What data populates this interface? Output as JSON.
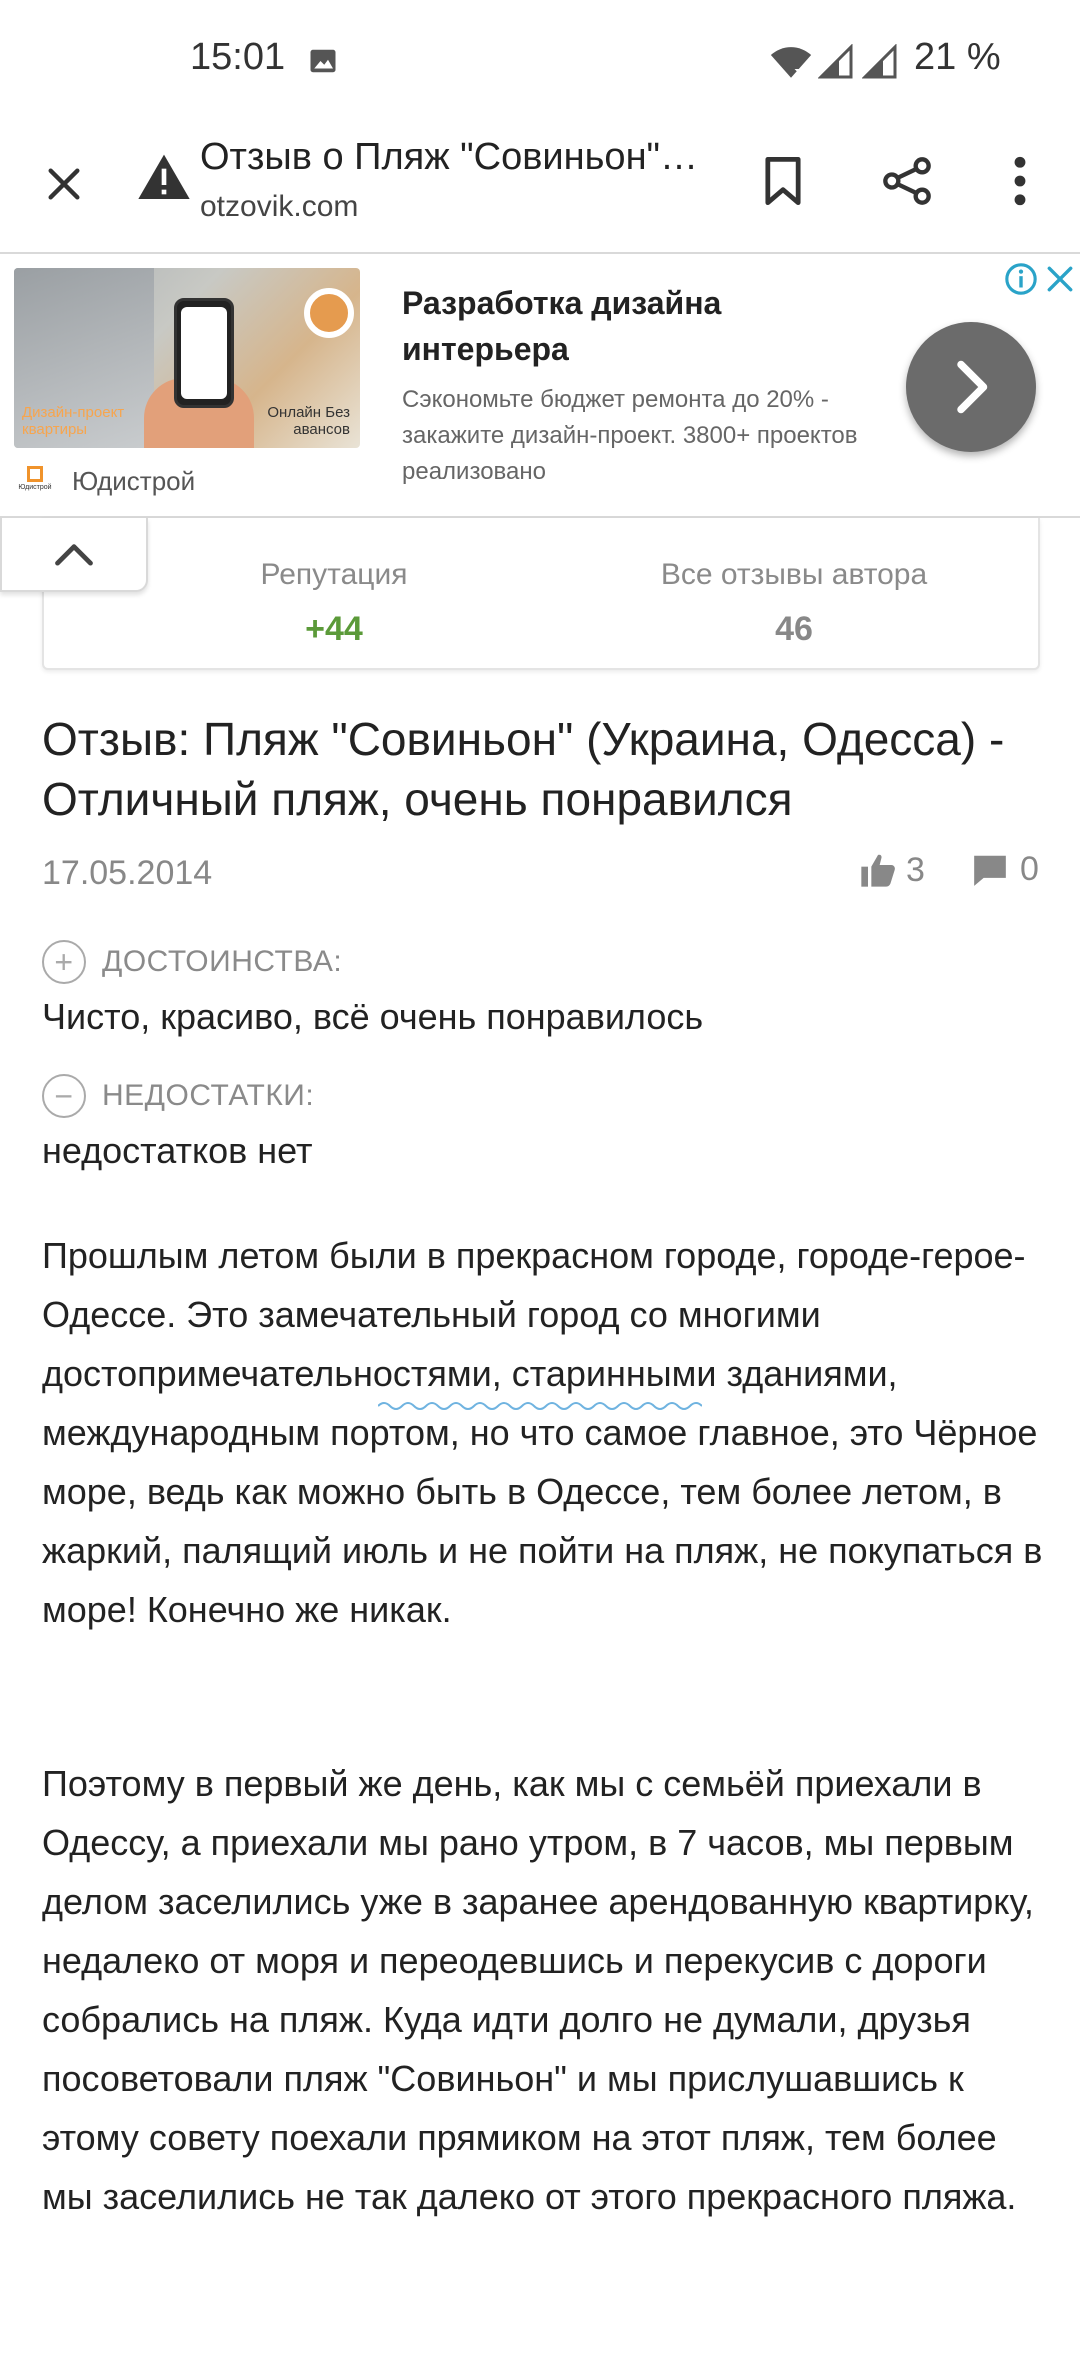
{
  "status_bar": {
    "time": "15:01",
    "battery": "21 %"
  },
  "toolbar": {
    "title": "Отзыв о Пляж \"Совиньон\" (Украина, Одесса)",
    "url": "otzovik.com"
  },
  "ad": {
    "image_text_left": "Дизайн-проект квартиры",
    "image_text_right": "Онлайн Без авансов",
    "brand": "Юдистрой",
    "logo_label": "Юдистрой",
    "headline": "Разработка дизайна интерьера",
    "description": "Сэкономьте бюджет ремонта до 20% - закажите дизайн-проект. 3800+ проектов реализовано"
  },
  "author_stats": {
    "reputation_label": "Репутация",
    "reputation_value": "+44",
    "reviews_label": "Все отзывы автора",
    "reviews_value": "46"
  },
  "review": {
    "title": "Отзыв: Пляж \"Совиньон\" (Украина, Одесса) - Отличный пляж, очень понравился",
    "date": "17.05.2014",
    "likes": "3",
    "comments": "0",
    "pros_label": "ДОСТОИНСТВА:",
    "pros_text": "Чисто, красиво, всё очень понравилось",
    "cons_label": "НЕДОСТАТКИ:",
    "cons_text": "недостатков нет",
    "paragraph1": "Прошлым летом были в прекрасном городе, городе-герое- Одессе. Это замечательный город со многими достопримечательностями, старинными зданиями, международным портом, но что самое главное, это Чёрное море, ведь как можно быть в Одессе, тем более летом, в жаркий, палящий июль и не пойти на пляж, не покупаться в море! Конечно же никак.",
    "paragraph2": "Поэтому в первый же день, как мы с семьёй приехали в Одессу, а приехали мы рано утром, в 7 часов, мы первым делом заселились уже в заранее арендованную квартирку, недалеко от моря и переодевшись и перекусив с дороги собрались на пляж. Куда идти долго не думали, друзья посоветовали пляж \"Совиньон\" и мы прислушавшись к этому совету поехали прямиком на этот пляж, тем более мы заселились не так далеко от этого прекрасного пляжа."
  },
  "colors": {
    "reputation": "#5b9a39",
    "ad_info": "#2aa3c8",
    "ad_arrow_bg": "#6b6b6b"
  }
}
